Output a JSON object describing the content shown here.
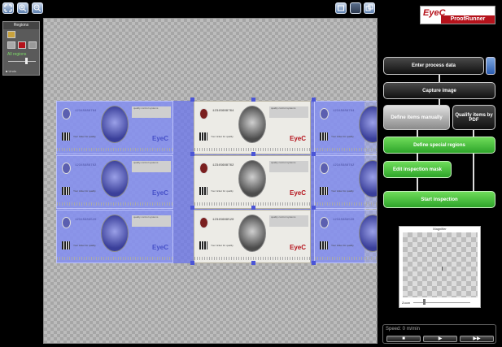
{
  "toolbar": {
    "left_icons": [
      "fit-view-icon",
      "zoom-in-icon",
      "zoom-out-icon"
    ],
    "right_icons": [
      "window-icon",
      "panel-icon",
      "expand-icon"
    ]
  },
  "regions_panel": {
    "title": "Regions",
    "green_label": "All regions",
    "undo_label": "Undo"
  },
  "ticket": {
    "numbers": [
      "12345688764",
      "12345688762",
      "12345689520"
    ],
    "quality_text": "quality control systems",
    "fine_print": "Your ticket for quality",
    "brand": "EyeC"
  },
  "logo": {
    "brand": "EyeC",
    "product": "ProofRunner"
  },
  "workflow": {
    "enter_process_data": "Enter process data",
    "capture_image": "Capture image",
    "define_items_manually": "Define items manually",
    "qualify_items_by_pdf": "Qualify items by PDF",
    "define_special_regions": "Define special regions",
    "edit_inspection_mask": "Edit inspection mask",
    "start_inspection": "Start inspection"
  },
  "magnifier": {
    "title": "Magnifier",
    "zoom_label": "Zoom",
    "zoom_level": 0.2
  },
  "speed": {
    "label": "Speed: 0 m/min",
    "buttons": [
      "■",
      "▶",
      "▶▶"
    ]
  },
  "colors": {
    "accent_red": "#b5121b",
    "workflow_green": "#3cba35",
    "overlay_blue": "#6e78eb"
  }
}
